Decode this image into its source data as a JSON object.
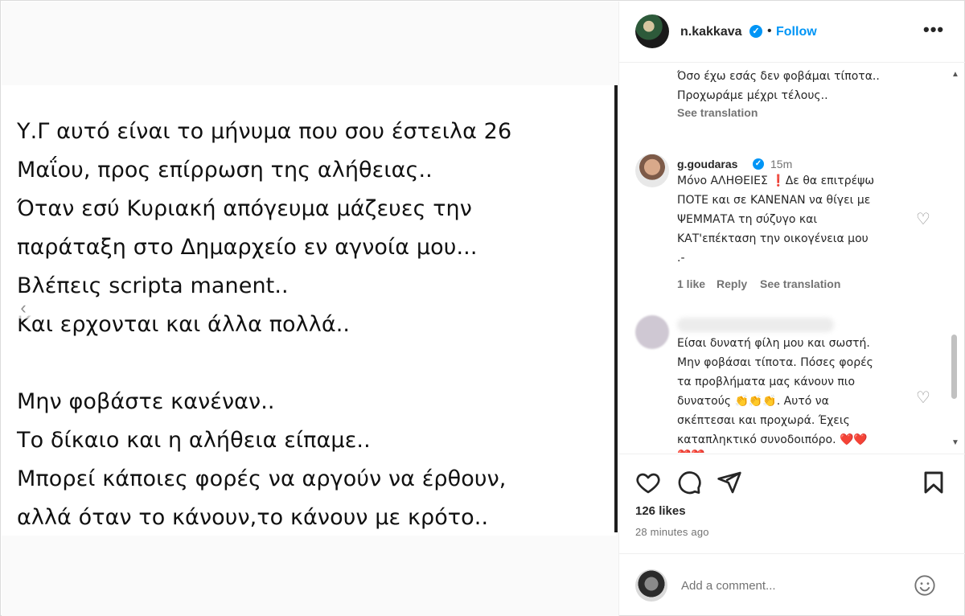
{
  "post": {
    "lines": [
      "Υ.Γ αυτό είναι το μήνυμα που σου έστειλα 26",
      "Μαΐου, προς επίρρωση της αλήθειας..",
      "Όταν εσύ Κυριακή απόγευμα μάζευες την",
      "παράταξη στο Δημαρχείο εν αγνοία μου...",
      "Βλέπεις scripta manent..",
      "Και ερχονται και άλλα πολλά..",
      "",
      "Μην φοβάστε κανέναν..",
      "Το δίκαιο και η αλήθεια είπαμε..",
      "Μπορεί κάποιες φορές να αργούν να έρθουν,",
      "αλλά όταν το κάνουν,το κάνουν με κρότο.."
    ]
  },
  "header": {
    "username": "n.kakkava",
    "separator": "•",
    "follow_label": "Follow",
    "more_label": "•••"
  },
  "comments": {
    "top_caption": {
      "lines": [
        "Όσο έχω εσάς δεν φοβάμαι τίποτα..",
        "Προχωράμε μέχρι τέλους.."
      ],
      "see_translation": "See translation"
    },
    "c1": {
      "username": "g.goudaras",
      "time": "15m",
      "lines": [
        "Μόνο ΑΛΗΘΕΙΕΣ ❗Δε θα επιτρέψω",
        "ΠΟΤΕ και σε ΚΑΝΕΝΑΝ να θίγει με",
        "ΨΕΜΜΑΤΑ τη σύζυγο και",
        "ΚΑΤ'επέκταση την οικογένεια μου",
        ".-"
      ],
      "likes": "1 like",
      "reply": "Reply",
      "see_translation": "See translation"
    },
    "c2": {
      "lines": [
        "Είσαι δυνατή φίλη μου και σωστή.",
        "Μην φοβάσαι τίποτα. Πόσες φορές",
        "τα προβλήματα μας κάνουν πιο",
        "δυνατούς 👏👏👏. Αυτό να",
        "σκέπτεσαι και προχωρά. Έχεις",
        "καταπληκτικό συνοδοιπόρο. ❤️❤️",
        "❤️❤️"
      ]
    }
  },
  "actions": {
    "likes": "126 likes",
    "time": "28 minutes ago"
  },
  "add_comment": {
    "placeholder": "Add a comment..."
  },
  "icons": {
    "heart": "heart-icon",
    "comment": "comment-icon",
    "share": "share-icon",
    "save": "bookmark-icon",
    "emoji": "emoji-icon"
  }
}
